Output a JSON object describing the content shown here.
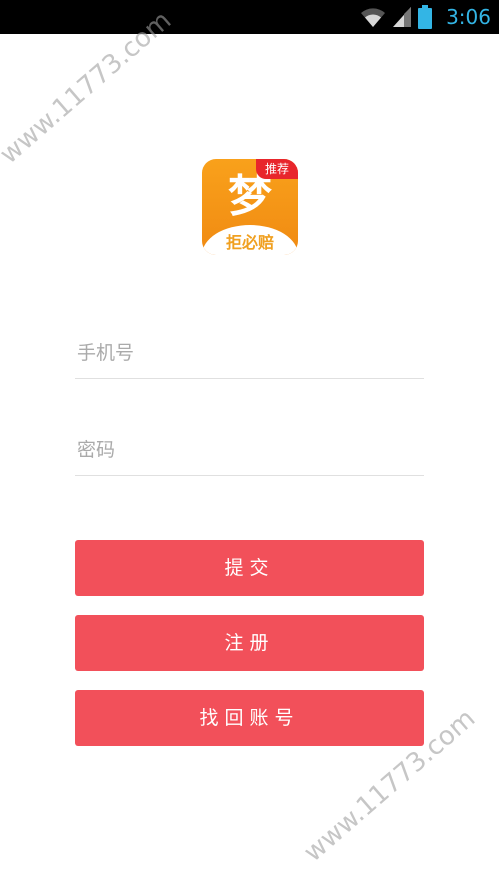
{
  "status_bar": {
    "time": "3:06",
    "icons": [
      "wifi-icon",
      "signal-icon",
      "battery-icon"
    ],
    "time_color": "#33b5e5"
  },
  "logo": {
    "badge": "推荐",
    "main_char": "梦",
    "subtitle": "拒必赔",
    "brand_color": "#f9a11b",
    "badge_color": "#e8262c"
  },
  "form": {
    "phone_placeholder": "手机号",
    "password_placeholder": "密码"
  },
  "buttons": {
    "submit_label": "提交",
    "register_label": "注册",
    "recover_label": "找回账号",
    "color": "#f2505a"
  },
  "watermark": {
    "text": "www.11773.com"
  }
}
